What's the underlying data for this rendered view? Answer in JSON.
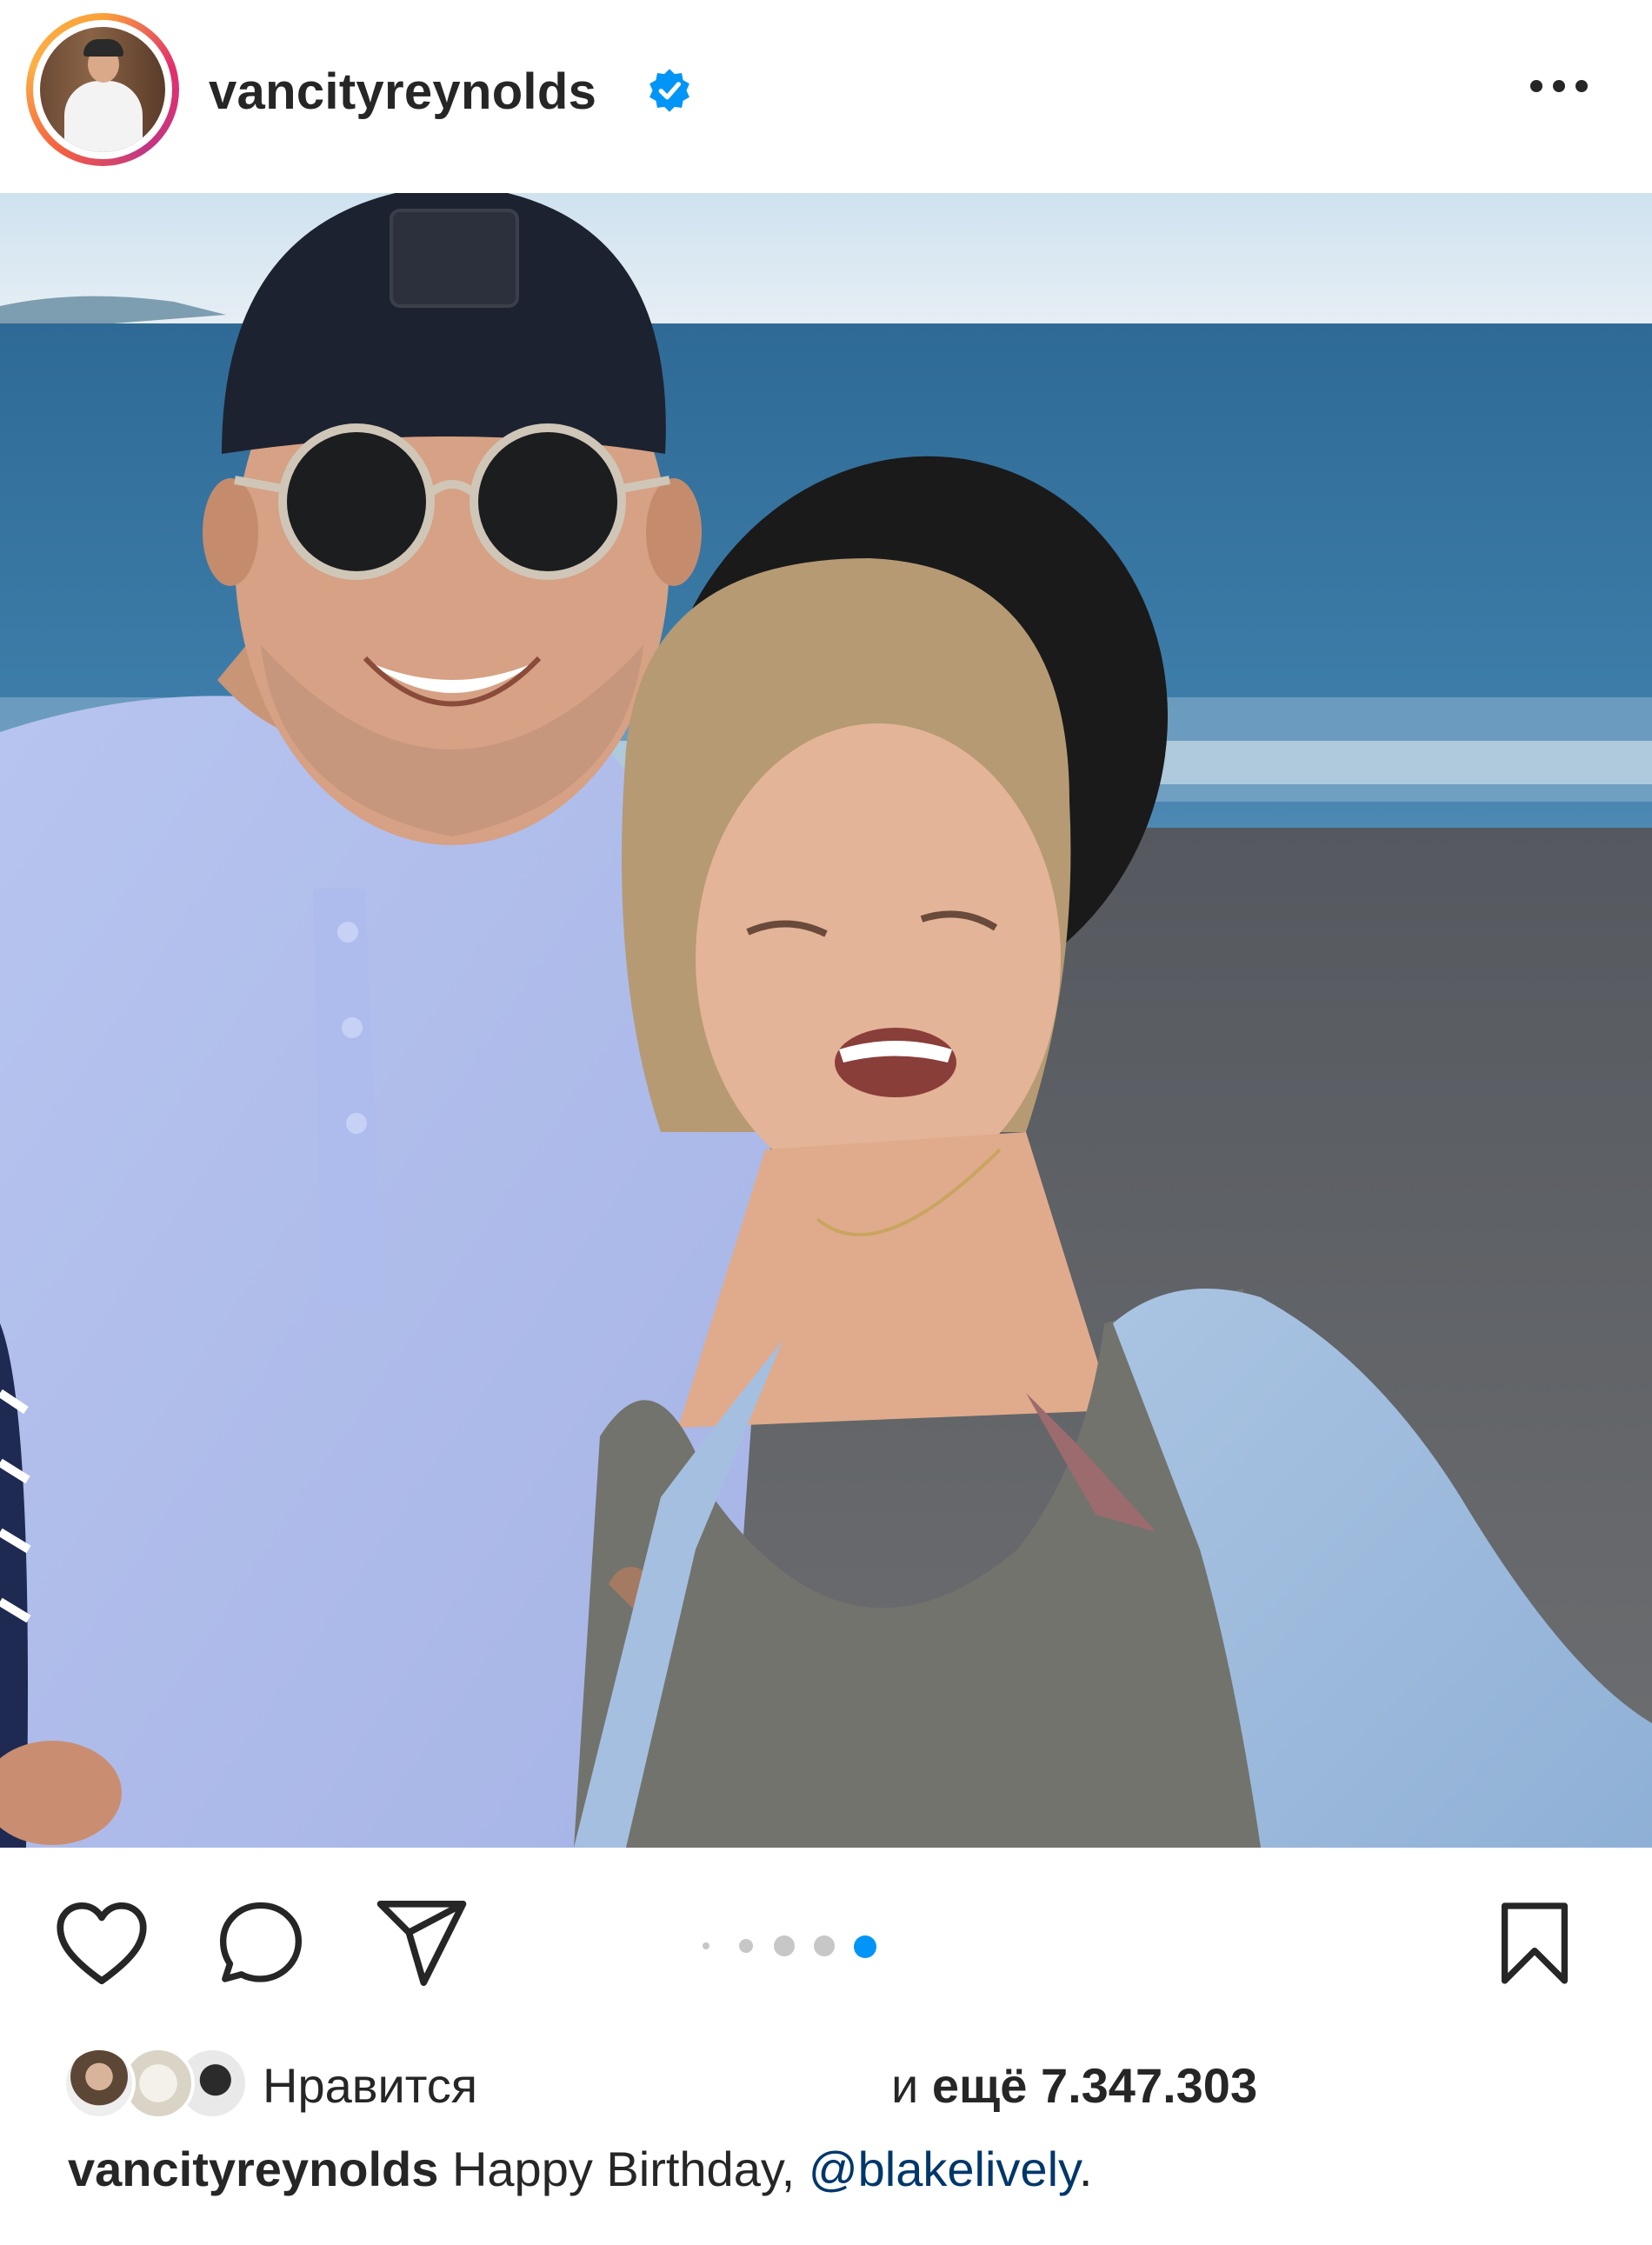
{
  "post": {
    "username": "vancityreynolds",
    "verified": true,
    "more_icon": "more-horizontal-icon",
    "photo_description_icon": "post-photo",
    "carousel": {
      "total": 5,
      "active_index": 4
    },
    "actions": {
      "like_icon": "heart-icon",
      "comment_icon": "comment-icon",
      "share_icon": "send-icon",
      "save_icon": "bookmark-icon"
    },
    "likes": {
      "label": "Нравится",
      "prefix": "и",
      "more_word": "ещё",
      "count": "7.347.303"
    },
    "caption": {
      "username": "vancityreynolds",
      "text": "Happy Birthday,",
      "mention": "@blakelively",
      "end": "."
    }
  },
  "colors": {
    "text": "#262626",
    "verified_blue": "#0095f6",
    "mention": "#00376b",
    "active_dot": "#0095f6"
  }
}
